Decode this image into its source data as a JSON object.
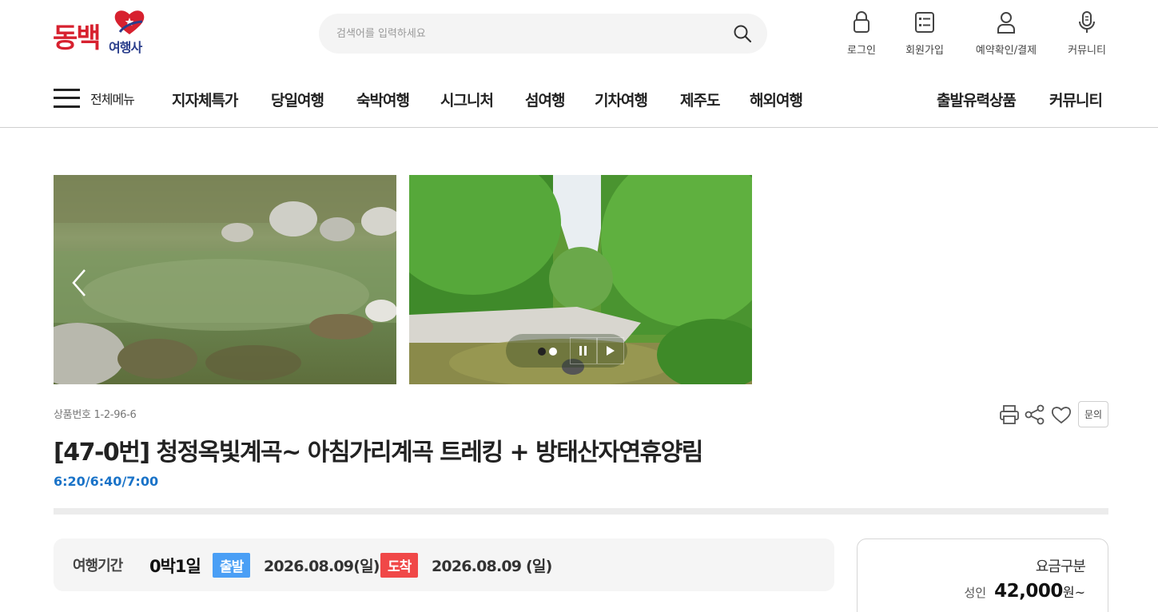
{
  "header": {
    "logo_main": "동백",
    "logo_sub": "여행사",
    "search_placeholder": "검색어를 입력하세요",
    "utils": [
      {
        "label": "로그인",
        "icon": "lock-icon"
      },
      {
        "label": "회원가입",
        "icon": "member-form-icon"
      },
      {
        "label": "예약확인/결제",
        "icon": "user-icon"
      },
      {
        "label": "커뮤니티",
        "icon": "microphone-icon"
      }
    ]
  },
  "gnb": {
    "all_menu": "전체메뉴",
    "items": [
      "지자체특가",
      "당일여행",
      "숙박여행",
      "시그니처",
      "섬여행",
      "기차여행",
      "제주도",
      "해외여행"
    ],
    "right_items": [
      "출발유력상품",
      "커뮤니티"
    ]
  },
  "gallery": {
    "images": [
      "valley-stream-photo",
      "forest-gorge-photo"
    ],
    "slide_count": 2,
    "active_slide": 1
  },
  "product": {
    "number": "상품번호 1-2-96-6",
    "title": "[47-0번] 청정옥빛계곡~ 아침가리계곡 트레킹 + 방태산자연휴양림",
    "times": "6:20/6:40/7:00",
    "inquiry": "문의"
  },
  "period": {
    "label": "여행기간",
    "duration": "0박1일",
    "depart_tag": "출발",
    "depart_date": "2026.08.09(일)",
    "arrive_tag": "도착",
    "arrive_date": "2026.08.09 (일)"
  },
  "price": {
    "heading": "요금구분",
    "type": "성인",
    "amount": "42,000",
    "unit": "원~"
  },
  "colors": {
    "brand_red": "#d7212f",
    "brand_navy": "#2a3e8c",
    "depart_blue": "#4a9ff5",
    "arrive_red": "#f04848",
    "time_blue": "#1a73c8"
  }
}
